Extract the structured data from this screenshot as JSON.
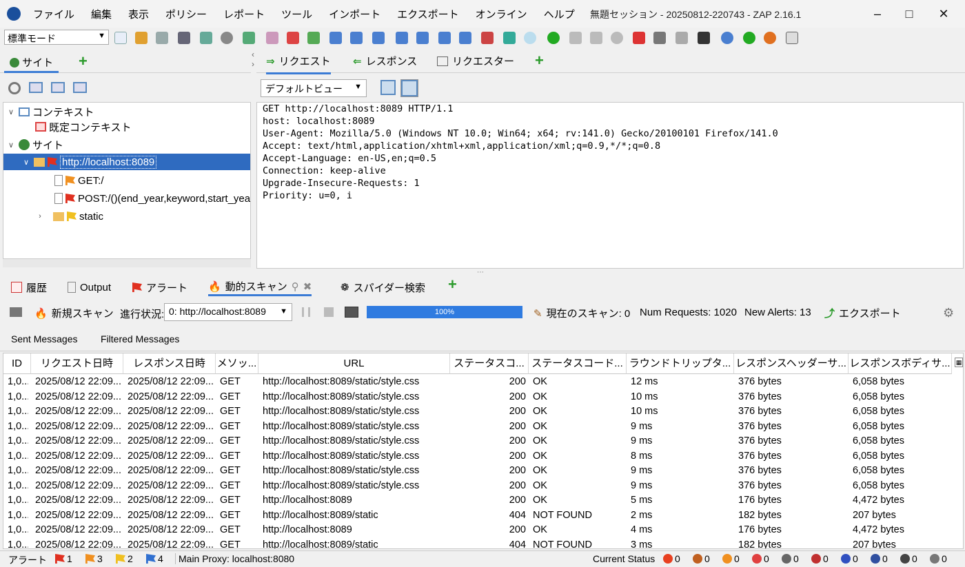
{
  "window": {
    "title": "無題セッション - 20250812-220743 - ZAP 2.16.1",
    "menu": [
      "ファイル",
      "編集",
      "表示",
      "ポリシー",
      "レポート",
      "ツール",
      "インポート",
      "エクスポート",
      "オンライン",
      "ヘルプ"
    ]
  },
  "toolbar": {
    "mode": "標準モード"
  },
  "left": {
    "tab_label": "サイト",
    "tree": {
      "contexts": "コンテキスト",
      "default_context": "既定コンテキスト",
      "sites": "サイト",
      "host": "http://localhost:8089",
      "child1": "GET:/",
      "child2": "POST:/()(end_year,keyword,start_year)",
      "child3": "static"
    }
  },
  "right": {
    "tabs": [
      "リクエスト",
      "レスポンス",
      "リクエスター"
    ],
    "view": "デフォルトビュー",
    "request_lines": [
      "GET http://localhost:8089 HTTP/1.1",
      "host: localhost:8089",
      "User-Agent: Mozilla/5.0 (Windows NT 10.0; Win64; x64; rv:141.0) Gecko/20100101 Firefox/141.0",
      "Accept: text/html,application/xhtml+xml,application/xml;q=0.9,*/*;q=0.8",
      "Accept-Language: en-US,en;q=0.5",
      "Connection: keep-alive",
      "Upgrade-Insecure-Requests: 1",
      "Priority: u=0, i"
    ]
  },
  "bottom": {
    "tabs": [
      "履歴",
      "Output",
      "アラート",
      "動的スキャン",
      "スパイダー検索"
    ],
    "new_scan": "新規スキャン",
    "progress_label": "進行状況:",
    "scan_target": "0: http://localhost:8089",
    "progress_percent": 100,
    "progress_text": "100%",
    "current_scans": "現在のスキャン: 0",
    "num_requests": "Num Requests: 1020",
    "new_alerts": "New Alerts: 13",
    "export": "エクスポート",
    "msg_tabs": [
      "Sent Messages",
      "Filtered Messages"
    ]
  },
  "table": {
    "headers": [
      "ID",
      "リクエスト日時",
      "レスポンス日時",
      "メソッ...",
      "URL",
      "ステータスコ...",
      "ステータスコード...",
      "ラウンドトリップタ...",
      "レスポンスヘッダーサ...",
      "レスポンスボディサ..."
    ],
    "rows": [
      [
        "1,0...",
        "2025/08/12 22:09...",
        "2025/08/12 22:09...",
        "GET",
        "http://localhost:8089/static/style.css",
        "200",
        "OK",
        "12 ms",
        "376 bytes",
        "6,058 bytes"
      ],
      [
        "1,0...",
        "2025/08/12 22:09...",
        "2025/08/12 22:09...",
        "GET",
        "http://localhost:8089/static/style.css",
        "200",
        "OK",
        "10 ms",
        "376 bytes",
        "6,058 bytes"
      ],
      [
        "1,0...",
        "2025/08/12 22:09...",
        "2025/08/12 22:09...",
        "GET",
        "http://localhost:8089/static/style.css",
        "200",
        "OK",
        "10 ms",
        "376 bytes",
        "6,058 bytes"
      ],
      [
        "1,0...",
        "2025/08/12 22:09...",
        "2025/08/12 22:09...",
        "GET",
        "http://localhost:8089/static/style.css",
        "200",
        "OK",
        "9 ms",
        "376 bytes",
        "6,058 bytes"
      ],
      [
        "1,0...",
        "2025/08/12 22:09...",
        "2025/08/12 22:09...",
        "GET",
        "http://localhost:8089/static/style.css",
        "200",
        "OK",
        "9 ms",
        "376 bytes",
        "6,058 bytes"
      ],
      [
        "1,0...",
        "2025/08/12 22:09...",
        "2025/08/12 22:09...",
        "GET",
        "http://localhost:8089/static/style.css",
        "200",
        "OK",
        "8 ms",
        "376 bytes",
        "6,058 bytes"
      ],
      [
        "1,0...",
        "2025/08/12 22:09...",
        "2025/08/12 22:09...",
        "GET",
        "http://localhost:8089/static/style.css",
        "200",
        "OK",
        "9 ms",
        "376 bytes",
        "6,058 bytes"
      ],
      [
        "1,0...",
        "2025/08/12 22:09...",
        "2025/08/12 22:09...",
        "GET",
        "http://localhost:8089/static/style.css",
        "200",
        "OK",
        "9 ms",
        "376 bytes",
        "6,058 bytes"
      ],
      [
        "1,0...",
        "2025/08/12 22:09...",
        "2025/08/12 22:09...",
        "GET",
        "http://localhost:8089",
        "200",
        "OK",
        "5 ms",
        "176 bytes",
        "4,472 bytes"
      ],
      [
        "1,0...",
        "2025/08/12 22:09...",
        "2025/08/12 22:09...",
        "GET",
        "http://localhost:8089/static",
        "404",
        "NOT FOUND",
        "2 ms",
        "182 bytes",
        "207 bytes"
      ],
      [
        "1,0...",
        "2025/08/12 22:09...",
        "2025/08/12 22:09...",
        "GET",
        "http://localhost:8089",
        "200",
        "OK",
        "4 ms",
        "176 bytes",
        "4,472 bytes"
      ],
      [
        "1,0...",
        "2025/08/12 22:09...",
        "2025/08/12 22:09...",
        "GET",
        "http://localhost:8089/static",
        "404",
        "NOT FOUND",
        "3 ms",
        "182 bytes",
        "207 bytes"
      ]
    ]
  },
  "status": {
    "alerts_label": "アラート",
    "flags": [
      {
        "count": "1",
        "color": "#e03020"
      },
      {
        "count": "3",
        "color": "#f09020"
      },
      {
        "count": "2",
        "color": "#f0c020"
      },
      {
        "count": "4",
        "color": "#3070d0"
      }
    ],
    "proxy": "Main Proxy: localhost:8080",
    "current_status": "Current Status",
    "counters": [
      "0",
      "0",
      "0",
      "0",
      "0",
      "0",
      "0",
      "0",
      "0",
      "0"
    ]
  }
}
